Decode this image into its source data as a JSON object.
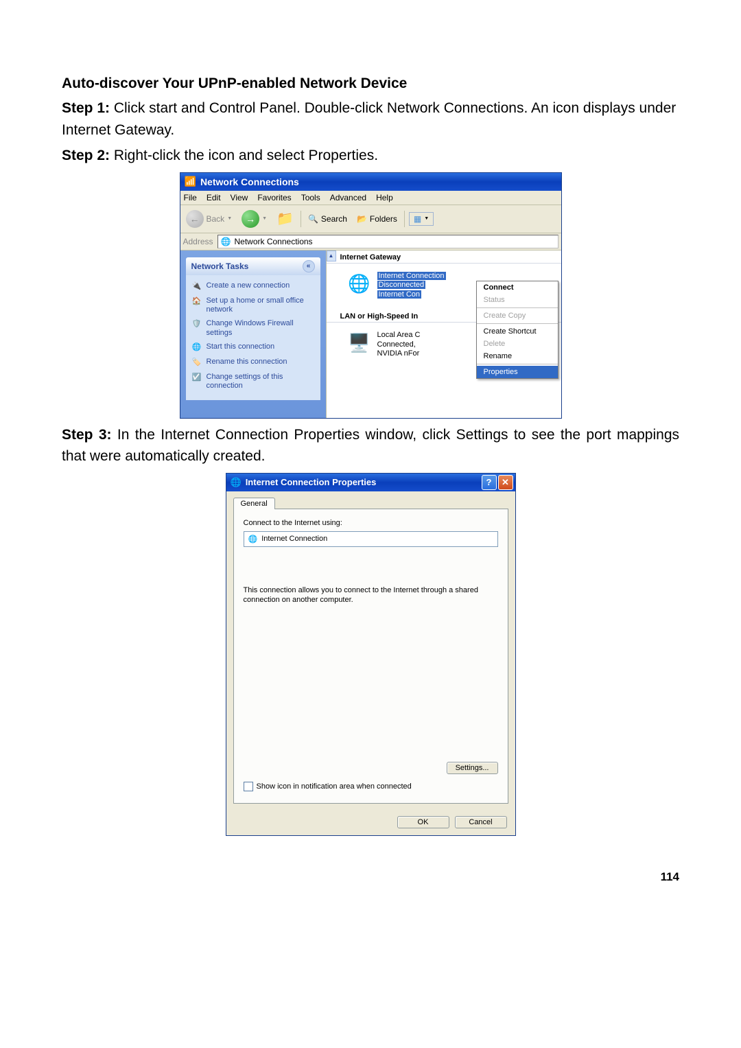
{
  "doc": {
    "heading": "Auto-discover Your UPnP-enabled Network Device",
    "step1_label": "Step 1:",
    "step1_text": " Click start and Control Panel. Double-click Network Connections. An icon displays under Internet Gateway.",
    "step2_label": "Step 2:",
    "step2_text": " Right-click the icon and select Properties.",
    "step3_label": "Step 3:",
    "step3_text": " In the Internet Connection Properties window, click Settings to see the port mappings that were automatically created.",
    "page_number": "114"
  },
  "win1": {
    "title": "Network Connections",
    "menubar": [
      "File",
      "Edit",
      "View",
      "Favorites",
      "Tools",
      "Advanced",
      "Help"
    ],
    "toolbar": {
      "back": "Back",
      "search": "Search",
      "folders": "Folders"
    },
    "address_label": "Address",
    "address_value": "Network Connections",
    "task_header": "Network Tasks",
    "tasks": [
      "Create a new connection",
      "Set up a home or small office network",
      "Change Windows Firewall settings",
      "Start this connection",
      "Rename this connection",
      "Change settings of this connection"
    ],
    "group1": "Internet Gateway",
    "item1_line1": "Internet Connection",
    "item1_line2": "Disconnected",
    "item1_line3": "Internet Con",
    "group2": "LAN or High-Speed In",
    "item2_line1": "Local Area C",
    "item2_line2": "Connected, ",
    "item2_line3": "NVIDIA nFor",
    "context": {
      "connect": "Connect",
      "status": "Status",
      "createcopy": "Create Copy",
      "createshortcut": "Create Shortcut",
      "delete": "Delete",
      "rename": "Rename",
      "properties": "Properties"
    }
  },
  "win2": {
    "title": "Internet Connection Properties",
    "tab": "General",
    "connect_label": "Connect to the Internet using:",
    "conn_name": "Internet Connection",
    "description": "This connection allows you to connect to the Internet through a shared connection on another computer.",
    "settings_btn": "Settings...",
    "checkbox": "Show icon in notification area when connected",
    "ok": "OK",
    "cancel": "Cancel"
  }
}
